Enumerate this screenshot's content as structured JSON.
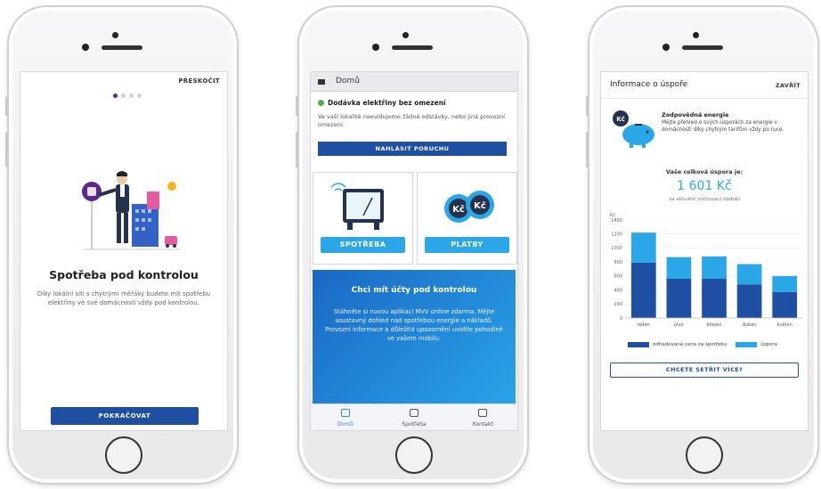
{
  "screen1": {
    "skip_label": "PŘESKOČIT",
    "title": "Spotřeba pod kontrolou",
    "text": "Díky lokální síti s chytrými měřáky budete mít spotřebu elektřiny ve své domácnosti vždy pod kontrolou.",
    "cta_label": "POKRAČOVAT",
    "page_dots": 4,
    "active_dot": 1
  },
  "screen2": {
    "appbar_title": "Domů",
    "status_title": "Dodávka elektřiny bez omezení",
    "status_text": "Ve vaší lokalitě neevidujeme žádné odstávky, nebo jiná provozní omezení.",
    "report_label": "NAHLÁSIT PORUCHU",
    "tile1_label": "SPOTŘEBA",
    "tile2_label": "PLATBY",
    "promo_title": "Chci mít účty pod kontrolou",
    "promo_text": "Stáhněte si novou aplikaci MVV online zdarma. Mějte soustavný dohled nad spotřebou energie a nákladů. Provozní informace a důležitá upozornění uvidíte pohodlně ve vašem mobilu.",
    "tabs": [
      {
        "label": "Domů",
        "icon": "home-icon",
        "active": true
      },
      {
        "label": "Spotřeba",
        "icon": "meter-icon",
        "active": false
      },
      {
        "label": "Kontakt",
        "icon": "contact-icon",
        "active": false
      }
    ],
    "colors": {
      "accent": "#2ba7e8",
      "primary": "#1e4fa3",
      "ok": "#4cae4c"
    }
  },
  "screen3": {
    "title": "Informace o úspoře",
    "close_label": "ZAVŘÍT",
    "info_title": "Zodpovědná energie",
    "info_text": "Mějte přehled o svých úsporách za energie v domácnosti díky chytrým tarifům vždy po ruce.",
    "savings_label": "Vaše celková úspora je:",
    "savings_value": "1 601 Kč",
    "savings_sub": "za aktuální zúčtovací období",
    "more_label": "CHCETE SETŘIT VÍCE?",
    "legend": [
      "odhadovaná cena za spotřebu",
      "úspora"
    ]
  },
  "chart_data": {
    "type": "bar",
    "stacked": true,
    "ylabel": "Kč",
    "ylim": [
      0,
      1400
    ],
    "yticks": [
      "0",
      "200",
      "400",
      "600",
      "800",
      "1000",
      "1200",
      "1400"
    ],
    "categories": [
      "leden",
      "únor",
      "březen",
      "duben",
      "květen"
    ],
    "series": [
      {
        "name": "odhadovaná cena za spotřebu",
        "color": "#1e4fa3",
        "values": [
          790,
          560,
          560,
          480,
          370
        ]
      },
      {
        "name": "úspora",
        "color": "#2ba7e8",
        "values": [
          430,
          310,
          320,
          290,
          230
        ]
      }
    ]
  }
}
